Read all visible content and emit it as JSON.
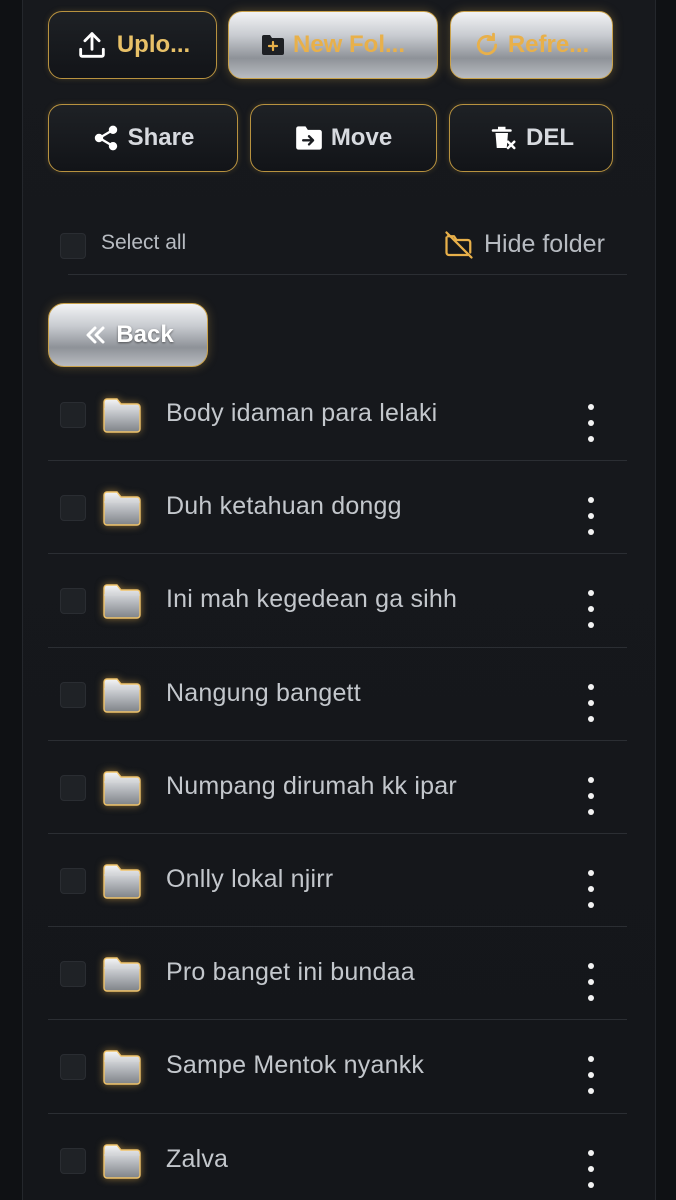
{
  "toolbar": {
    "upload_label": "Uplo...",
    "new_folder_label": "New Fol...",
    "refresh_label": "Refre...",
    "share_label": "Share",
    "move_label": "Move",
    "delete_label": "DEL"
  },
  "selection": {
    "select_all_label": "Select all",
    "hide_folder_label": "Hide folder"
  },
  "nav": {
    "back_label": "Back"
  },
  "folders": [
    {
      "name": "Body idaman para lelaki"
    },
    {
      "name": "Duh ketahuan dongg"
    },
    {
      "name": "Ini mah kegedean ga sihh"
    },
    {
      "name": "Nangung bangett"
    },
    {
      "name": "Numpang dirumah kk ipar"
    },
    {
      "name": "Onlly lokal njirr"
    },
    {
      "name": "Pro banget ini bundaa"
    },
    {
      "name": "Sampe Mentok nyankk"
    },
    {
      "name": "Zalva"
    }
  ],
  "icons": {
    "upload": "upload-icon",
    "new_folder": "folder-plus-icon",
    "refresh": "refresh-icon",
    "share": "share-icon",
    "move": "folder-move-icon",
    "delete": "trash-x-icon",
    "hide_folder": "folder-off-icon",
    "back": "chevrons-left-icon",
    "folder": "folder-icon",
    "more": "more-vertical-icon"
  },
  "colors": {
    "accent_gold": "#e8c168",
    "background": "#14161a",
    "text": "#c3c7cc"
  }
}
